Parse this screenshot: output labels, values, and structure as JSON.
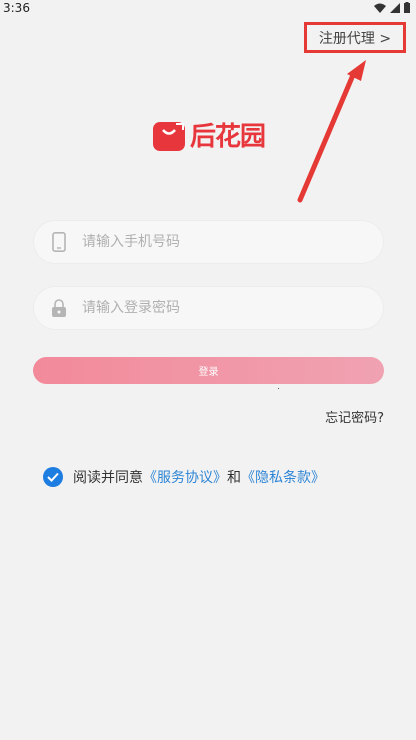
{
  "status_bar": {
    "time": "3:36"
  },
  "header": {
    "register_agent_label": "注册代理 >"
  },
  "logo": {
    "text": "后花园"
  },
  "form": {
    "phone_placeholder": "请输入手机号码",
    "password_placeholder": "请输入登录密码",
    "login_label": "登录",
    "forgot_label": "忘记密码?"
  },
  "agreement": {
    "prefix": "阅读并同意",
    "service_link": "《服务协议》",
    "and": "和",
    "privacy_link": "《隐私条款》",
    "checked": true
  },
  "colors": {
    "accent": "#e8363d",
    "link": "#2f86d6",
    "highlight_box": "#e53935",
    "checkbox": "#1e7de0"
  }
}
